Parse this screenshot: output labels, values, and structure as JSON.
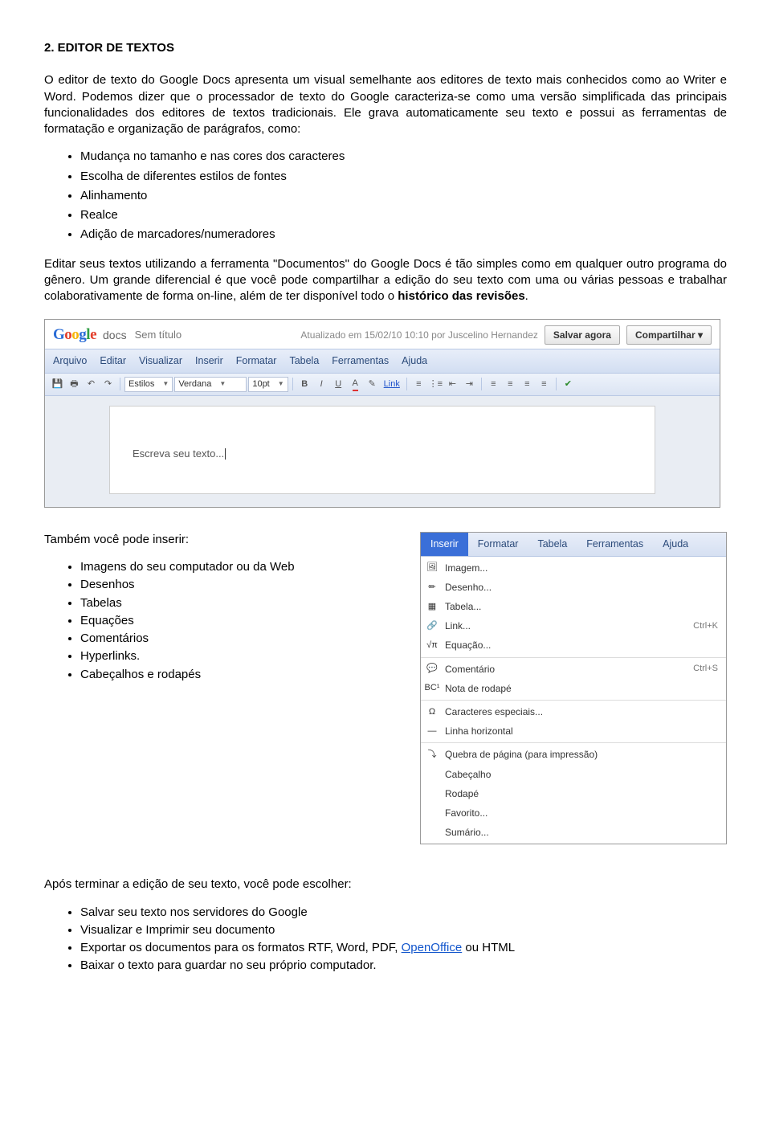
{
  "section": {
    "title": "2. EDITOR DE TEXTOS",
    "p1": "O editor de texto do Google Docs apresenta um visual semelhante aos editores de texto mais conhecidos como ao Writer e Word. Podemos dizer que o processador de texto do Google caracteriza-se como uma versão simplificada das principais funcionalidades dos editores de textos tradicionais. Ele grava automaticamente seu texto e possui as ferramentas de formatação e organização de parágrafos, como:",
    "bullets1": [
      "Mudança no tamanho e nas cores dos caracteres",
      "Escolha de diferentes estilos de fontes",
      "Alinhamento",
      "Realce",
      "Adição de marcadores/numeradores"
    ],
    "p2a": "Editar seus textos utilizando a ferramenta \"Documentos\" do Google Docs é tão simples como em qualquer outro programa do gênero. Um grande diferencial é que você pode compartilhar a edição do seu texto com uma ou várias pessoas e trabalhar colaborativamente de forma on-line, além de ter disponível todo o ",
    "p2b": "histórico das revisões",
    "p2c": ".",
    "insert_intro": "Também você pode inserir:",
    "bullets2": [
      "Imagens do seu computador ou  da Web",
      "Desenhos",
      "Tabelas",
      "Equações",
      "Comentários",
      "Hyperlinks.",
      "Cabeçalhos e rodapés"
    ],
    "after_intro": "Após terminar a edição de seu texto, você pode escolher:",
    "bullets3_pre": [
      "Salvar seu texto nos servidores do Google",
      "Visualizar e Imprimir seu documento"
    ],
    "bullet3_export_pre": "Exportar os documentos para os formatos RTF, Word, PDF, ",
    "bullet3_export_link": "OpenOffice",
    "bullet3_export_post": " ou HTML",
    "bullet3_last": "Baixar o texto para guardar no seu próprio computador."
  },
  "gdocs": {
    "logo_docs": "docs",
    "doc_title": "Sem título",
    "updated": "Atualizado em 15/02/10 10:10 por Juscelino Hernandez",
    "btn_save": "Salvar agora",
    "btn_share": "Compartilhar ▾",
    "menu": [
      "Arquivo",
      "Editar",
      "Visualizar",
      "Inserir",
      "Formatar",
      "Tabela",
      "Ferramentas",
      "Ajuda"
    ],
    "style_combo": "Estilos",
    "font_combo": "Verdana",
    "size_combo": "10pt",
    "link_label": "Link",
    "page_placeholder": "Escreva seu texto..."
  },
  "insert_menu": {
    "tabs": [
      "Inserir",
      "Formatar",
      "Tabela",
      "Ferramentas",
      "Ajuda"
    ],
    "items": [
      {
        "label": "Imagem...",
        "icon": "🖼",
        "sc": ""
      },
      {
        "label": "Desenho...",
        "icon": "✏",
        "sc": ""
      },
      {
        "label": "Tabela...",
        "icon": "▦",
        "sc": ""
      },
      {
        "label": "Link...",
        "icon": "🔗",
        "sc": "Ctrl+K"
      },
      {
        "label": "Equação...",
        "icon": "√π",
        "sc": ""
      },
      {
        "sep": true
      },
      {
        "label": "Comentário",
        "icon": "💬",
        "sc": "Ctrl+S"
      },
      {
        "label": "Nota de rodapé",
        "icon": "BC¹",
        "sc": ""
      },
      {
        "sep": true
      },
      {
        "label": "Caracteres especiais...",
        "icon": "Ω",
        "sc": ""
      },
      {
        "label": "Linha horizontal",
        "icon": "—",
        "sc": ""
      },
      {
        "sep": true
      },
      {
        "label": "Quebra de página (para impressão)",
        "icon": "⤵",
        "sc": ""
      },
      {
        "label": "Cabeçalho",
        "icon": "",
        "sc": ""
      },
      {
        "label": "Rodapé",
        "icon": "",
        "sc": ""
      },
      {
        "label": "Favorito...",
        "icon": "",
        "sc": ""
      },
      {
        "label": "Sumário...",
        "icon": "",
        "sc": ""
      }
    ]
  }
}
